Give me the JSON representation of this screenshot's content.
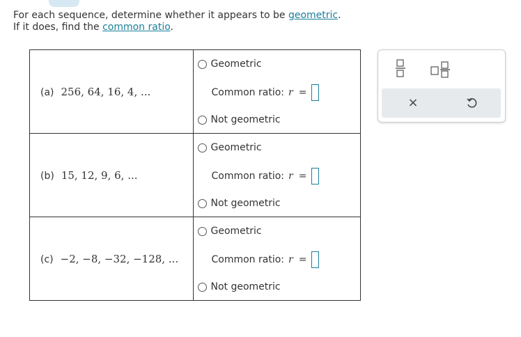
{
  "instructions": {
    "line1_prefix": "For each sequence, determine whether it appears to be ",
    "line1_link": "geometric",
    "line1_suffix": ".",
    "line2_prefix": "If it does, find the ",
    "line2_link": "common ratio",
    "line2_suffix": "."
  },
  "rows": [
    {
      "letter": "(a)",
      "sequence": "256, 64, 16, 4, ...",
      "geometric_label": "Geometric",
      "ratio_label": "Common ratio:",
      "ratio_var": "r",
      "equals": "=",
      "not_geometric_label": "Not geometric"
    },
    {
      "letter": "(b)",
      "sequence": "15, 12, 9, 6, ...",
      "geometric_label": "Geometric",
      "ratio_label": "Common ratio:",
      "ratio_var": "r",
      "equals": "=",
      "not_geometric_label": "Not geometric"
    },
    {
      "letter": "(c)",
      "sequence": "−2, −8, −32, −128, ...",
      "geometric_label": "Geometric",
      "ratio_label": "Common ratio:",
      "ratio_var": "r",
      "equals": "=",
      "not_geometric_label": "Not geometric"
    }
  ],
  "panel": {
    "clear_symbol": "×"
  },
  "colors": {
    "link": "#1a7f9a",
    "tab": "#d6e9f3",
    "panel_bar": "#e6eaed"
  }
}
